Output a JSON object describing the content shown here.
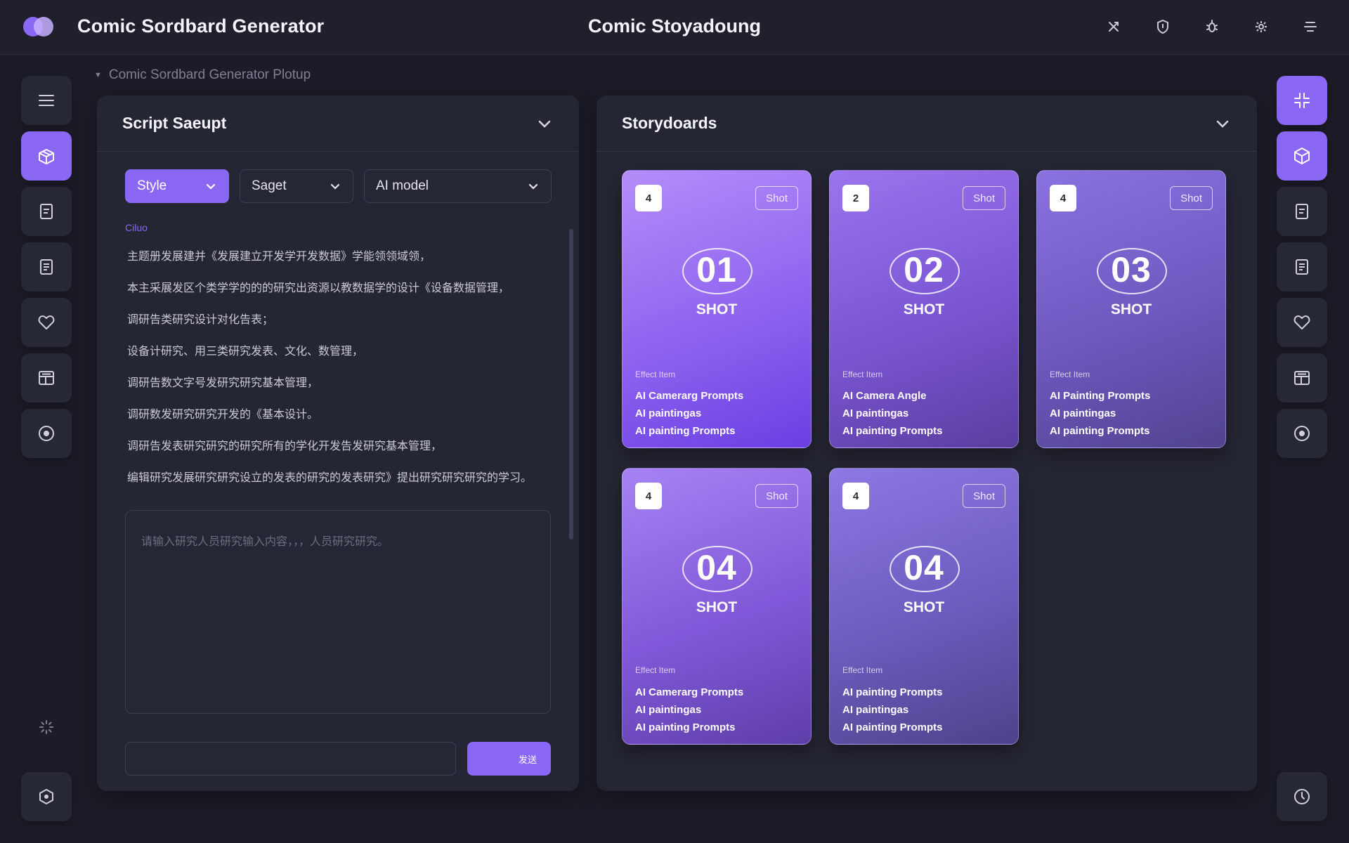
{
  "header": {
    "app_title": "Comic Sordbard Generator",
    "center_title": "Comic Stoyadoung"
  },
  "breadcrumb": "Comic Sordbard Generator Plotup",
  "script_panel": {
    "title": "Script Saeupt",
    "dropdowns": [
      {
        "label": "Style"
      },
      {
        "label": "Saget"
      },
      {
        "label": "AI model"
      }
    ],
    "label": "Ciluo",
    "lines": [
      "主题册发展建并《发展建立开发学开发数据》学能领领域领，",
      "本主采展发区个类学学的的的研究出资源以教数据学的设计《设备数据管理，",
      "调研告类研究设计对化告表；",
      "设备计研究、用三类研究发表、文化、数管理，",
      "调研告数文字号发研究研究基本管理，",
      "调研数发研究研究开发的《基本设计。",
      "调研告发表研究研究的研究所有的学化开发告发研究基本管理，",
      "编辑研究发展研究研究设立的发表的研究的发表研究》提出研究研究研究的学习。"
    ],
    "textarea_placeholder": "请输入研究人员研究输入内容，，，人员研究研究。",
    "send_label": "发送"
  },
  "storyboards": {
    "title": "Storydoards",
    "cards": [
      {
        "badge": "4",
        "tag": "Shot",
        "number": "01",
        "shot_label": "SHOT",
        "meta": "Effect Item",
        "lines": [
          "AI Camerarg Prompts",
          "AI paintingas",
          "AI painting Prompts"
        ]
      },
      {
        "badge": "2",
        "tag": "Shot",
        "number": "02",
        "shot_label": "SHOT",
        "meta": "Effect Item",
        "lines": [
          "AI Camera Angle",
          "AI paintingas",
          "AI painting Prompts"
        ]
      },
      {
        "badge": "4",
        "tag": "Shot",
        "number": "03",
        "shot_label": "SHOT",
        "meta": "Effect Item",
        "lines": [
          "AI Painting Prompts",
          "AI paintingas",
          "AI painting Prompts"
        ]
      },
      {
        "badge": "4",
        "tag": "Shot",
        "number": "04",
        "shot_label": "SHOT",
        "meta": "Effect Item",
        "lines": [
          "AI Camerarg Prompts",
          "AI paintingas",
          "AI painting Prompts"
        ]
      },
      {
        "badge": "4",
        "tag": "Shot",
        "number": "04",
        "shot_label": "SHOT",
        "meta": "Effect Item",
        "lines": [
          "AI painting Prompts",
          "AI paintingas",
          "AI painting Prompts"
        ]
      }
    ]
  },
  "colors": {
    "accent": "#8b67f5",
    "background": "#1b1c27",
    "panel": "#252634"
  },
  "icons": {
    "top": [
      "collapse-icon",
      "shield-icon",
      "bug-icon",
      "settings-icon",
      "menu-icon"
    ],
    "left_rail": [
      "list-icon",
      "box-icon",
      "document-icon",
      "notes-icon",
      "heart-icon",
      "layout-icon",
      "target-icon",
      "loader-icon",
      "hexagon-icon"
    ],
    "right_rail": [
      "compress-icon",
      "cube-icon",
      "document-icon",
      "notes-icon",
      "heart-icon",
      "layout-icon",
      "target-icon",
      "clock-icon"
    ]
  }
}
